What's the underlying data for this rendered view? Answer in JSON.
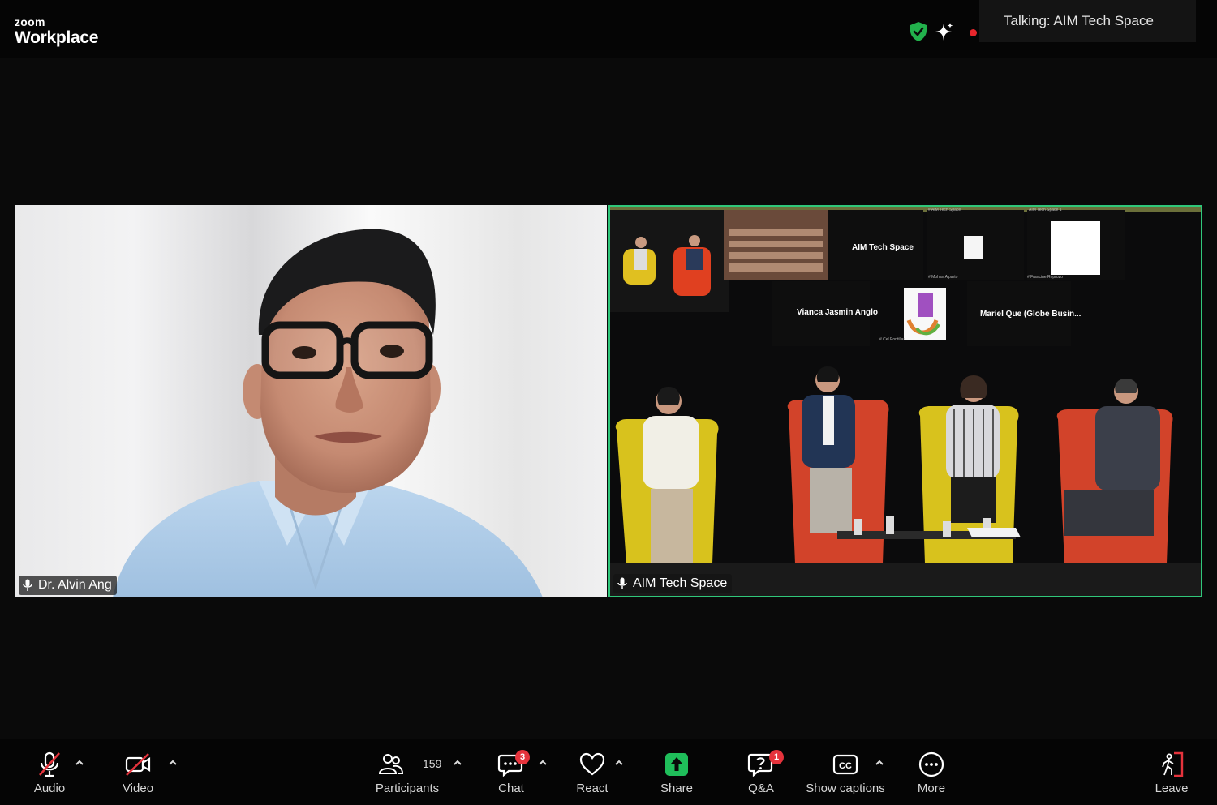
{
  "app": {
    "brand_top": "zoom",
    "brand_bottom": "Workplace"
  },
  "talking": {
    "label": "Talking: AIM Tech Space"
  },
  "tiles": {
    "left": {
      "name": "Dr. Alvin Ang"
    },
    "right": {
      "name": "AIM Tech Space",
      "gallery": {
        "label_aim": "AIM Tech Space",
        "label_vianca": "Vianca Jasmin Anglo",
        "label_mariel": "Mariel Que (Globe Busin...",
        "tiny_mohan": "# Mohan Alparto",
        "tiny_francine": "# Francine Reprozo",
        "tiny_cel": "# Cel Pontillan",
        "tiny_aim1": "AIM Tech Space 1",
        "tiny_aim": "# AIM Tech Space"
      }
    }
  },
  "toolbar": {
    "audio": "Audio",
    "video": "Video",
    "participants": "Participants",
    "participants_count": "159",
    "chat": "Chat",
    "chat_badge": "3",
    "react": "React",
    "share": "Share",
    "qa": "Q&A",
    "qa_badge": "1",
    "captions": "Show captions",
    "more": "More",
    "leave": "Leave"
  },
  "colors": {
    "active_speaker_border": "#30c77a",
    "share_green": "#1fbe5a",
    "badge_red": "#e5333c",
    "leave_red": "#e5333c",
    "shield_green": "#22b14c"
  }
}
